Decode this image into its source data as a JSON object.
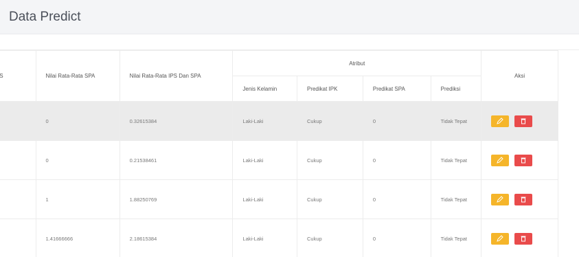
{
  "page": {
    "title": "Data Predict"
  },
  "table": {
    "headers": {
      "col_ips": "a IPS",
      "col_spa": "Nilai Rata-Rata SPA",
      "col_ips_spa": "Nilai Rata-Rata IPS Dan SPA",
      "group_attr": "Atribut",
      "col_gender": "Jenis Kelamin",
      "col_pred_ipk": "Predikat IPK",
      "col_pred_spa": "Predikat SPA",
      "col_prediksi": "Prediksi",
      "col_aksi": "Aksi"
    },
    "rows": [
      {
        "ips": "",
        "spa": "0",
        "ips_spa": "0.32615384",
        "gender": "Laki-Laki",
        "pred_ipk": "Cukup",
        "pred_spa": "0",
        "prediksi": "Tidak Tepat"
      },
      {
        "ips": "",
        "spa": "0",
        "ips_spa": "0.21538461",
        "gender": "Laki-Laki",
        "pred_ipk": "Cukup",
        "pred_spa": "0",
        "prediksi": "Tidak Tepat"
      },
      {
        "ips": "",
        "spa": "1",
        "ips_spa": "1.88250769",
        "gender": "Laki-Laki",
        "pred_ipk": "Cukup",
        "pred_spa": "0",
        "prediksi": "Tidak Tepat"
      },
      {
        "ips": "",
        "spa": "1.41666666",
        "ips_spa": "2.18615384",
        "gender": "Laki-Laki",
        "pred_ipk": "Cukup",
        "pred_spa": "0",
        "prediksi": "Tidak Tepat"
      }
    ]
  },
  "colors": {
    "edit": "#f5b52a",
    "delete": "#e94b4b",
    "highlight_row": "#ebebeb"
  },
  "icons": {
    "edit": "edit-icon",
    "delete": "trash-icon"
  }
}
